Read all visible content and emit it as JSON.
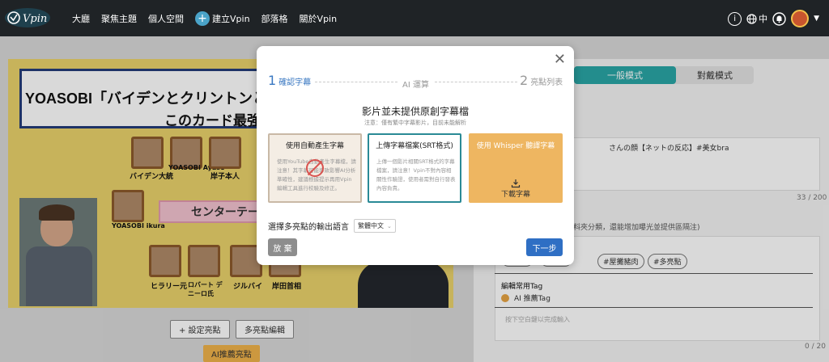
{
  "nav": {
    "logo_text": "Vpin",
    "links": [
      "大廳",
      "聚焦主題",
      "個人空間"
    ],
    "create_label": "建立Vpin",
    "links2": [
      "部落格",
      "關於Vpin"
    ],
    "info_glyph": "i",
    "lang_label": "中",
    "icons": [
      "info-icon",
      "globe-icon",
      "bell-icon",
      "avatar",
      "chevron-down-icon"
    ]
  },
  "video": {
    "banner_line1": "YOASOBI「バイデンとクリントンとロバー",
    "banner_line2": "このカード最強す",
    "center_label": "センターテー",
    "names": [
      "バイデン大統",
      "YOASOBI Ayase",
      "岸子本人",
      "YOASOBI ikura",
      "ヒラリー元",
      "ロバート デ ニーロ氏",
      "ジルバイ",
      "岸田首相"
    ]
  },
  "left_buttons": {
    "set_highlight": "+ 設定亮點",
    "multi_edit": "多亮點編輯",
    "ai_recommend": "AI推薦亮點"
  },
  "right_panel": {
    "mode_normal": "一般模式",
    "mode_dialog": "對戴模式",
    "title_value": "さんの顔【ネットの反応】#美女bra",
    "title_count": "33 / 200",
    "hint": "覆資料夾分類，還能增加曝光並提供區隔注)",
    "tags": [
      "ecipe",
      "#屋攤豬肉",
      "#多亮點"
    ],
    "common_tag_label": "編輯常用Tag",
    "ai_tag_label": "AI 推薦Tag",
    "tag_placeholder": "按下空白鍵以完成輸入",
    "tag_count": "0 / 20"
  },
  "modal": {
    "step1_num": "1",
    "step1_label": "確認字幕",
    "step_mid": "AI 運算",
    "step2_num": "2",
    "step2_label": "亮點列表",
    "heading": "影片並未提供原創字幕檔",
    "note": "注意：僅有繁中字幕影片，目前未能解析",
    "options": [
      {
        "title": "使用自動產生字幕",
        "body": "使用YouTube自動產生字幕檔，請注意！其字幕可能導致影響AI分析準確性，建議根據提示再用Vpin編輯工具進行校驗及修正。"
      },
      {
        "title": "上傳字幕檔案(SRT格式)",
        "body": "上傳一個影片相關SRT格式的字幕檔案，請注意！Vpin不對內容相關性作驗證，使用者需對自行發表內容負責。"
      },
      {
        "title": "使用 Whisper 聽譯字幕",
        "download_label": "下載字幕"
      }
    ],
    "lang_label": "選擇多亮點的輸出語言",
    "lang_value": "繁體中文",
    "cancel_label": "放 棄",
    "next_label": "下一步"
  }
}
